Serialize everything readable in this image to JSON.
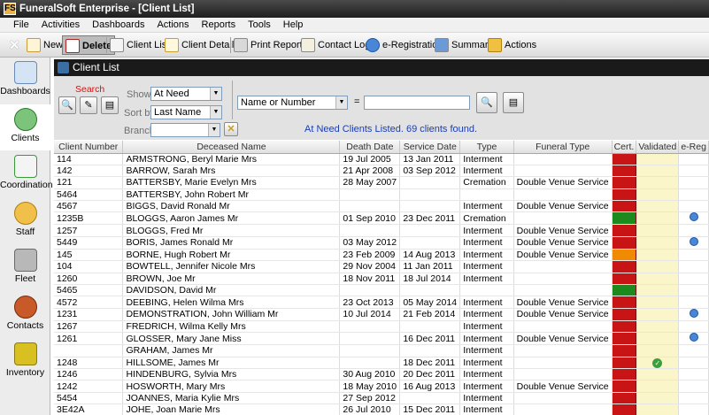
{
  "window": {
    "title": "FuneralSoft Enterprise - [Client List]",
    "logo_text": "FS"
  },
  "menu": [
    "File",
    "Activities",
    "Dashboards",
    "Actions",
    "Reports",
    "Tools",
    "Help"
  ],
  "toolbar": {
    "new": "New",
    "delete": "Delete",
    "client_list": "Client List",
    "client_details": "Client Details",
    "print_reports": "Print Reports",
    "contact_log": "Contact Log",
    "e_registration": "e-Registration",
    "summary": "Summary",
    "actions": "Actions"
  },
  "sidebar": {
    "items": [
      {
        "label": "Dashboards",
        "icon": "dashboard-icon"
      },
      {
        "label": "Clients",
        "icon": "clients-icon"
      },
      {
        "label": "Coordination",
        "icon": "calendar-icon"
      },
      {
        "label": "Staff",
        "icon": "staff-icon"
      },
      {
        "label": "Fleet",
        "icon": "key-icon"
      },
      {
        "label": "Contacts",
        "icon": "contacts-icon"
      },
      {
        "label": "Inventory",
        "icon": "truck-icon"
      }
    ]
  },
  "panel": {
    "title": "Client List"
  },
  "search": {
    "heading": "Search",
    "show_label": "Show:",
    "show_value": "At Need",
    "sort_label": "Sort by:",
    "sort_value": "Last Name",
    "branch_label": "Branch:",
    "branch_value": "",
    "field_value": "Name or Number",
    "equals": "=",
    "query_value": "",
    "clear_symbol": "✕",
    "info": "At Need Clients Listed. 69 clients found."
  },
  "table": {
    "columns": [
      "Client Number",
      "Deceased Name",
      "Death Date",
      "Service Date",
      "Type",
      "Funeral Type",
      "Cert.",
      "Validated",
      "e-Reg"
    ],
    "colors": {
      "red": "#c81414",
      "green": "#1c8a1c",
      "orange": "#f08a00"
    },
    "rows": [
      {
        "num": "114",
        "name": "ARMSTRONG, Beryl Marie Mrs",
        "death": "19 Jul 2005",
        "service": "13 Jan 2011",
        "type": "Interment",
        "funeral": "",
        "cert": "red",
        "valid": "",
        "ereg": ""
      },
      {
        "num": "142",
        "name": "BARROW, Sarah Mrs",
        "death": "21 Apr 2008",
        "service": "03 Sep 2012",
        "type": "Interment",
        "funeral": "",
        "cert": "red",
        "valid": "",
        "ereg": ""
      },
      {
        "num": "121",
        "name": "BATTERSBY, Marie Evelyn Mrs",
        "death": "28 May 2007",
        "service": "",
        "type": "Cremation",
        "funeral": "Double Venue Service",
        "cert": "red",
        "valid": "",
        "ereg": ""
      },
      {
        "num": "5464",
        "name": "BATTERSBY, John Robert Mr",
        "death": "",
        "service": "",
        "type": "",
        "funeral": "",
        "cert": "red",
        "valid": "",
        "ereg": ""
      },
      {
        "num": "4567",
        "name": "BIGGS, David Ronald Mr",
        "death": "",
        "service": "",
        "type": "Interment",
        "funeral": "Double Venue Service",
        "cert": "red",
        "valid": "",
        "ereg": ""
      },
      {
        "num": "1235B",
        "name": "BLOGGS, Aaron James Mr",
        "death": "01 Sep 2010",
        "service": "23 Dec 2011",
        "type": "Cremation",
        "funeral": "",
        "cert": "green",
        "valid": "",
        "ereg": "globe"
      },
      {
        "num": "1257",
        "name": "BLOGGS, Fred Mr",
        "death": "",
        "service": "",
        "type": "Interment",
        "funeral": "Double Venue Service",
        "cert": "red",
        "valid": "",
        "ereg": ""
      },
      {
        "num": "5449",
        "name": "BORIS, James Ronald Mr",
        "death": "03 May 2012",
        "service": "",
        "type": "Interment",
        "funeral": "Double Venue Service",
        "cert": "red",
        "valid": "",
        "ereg": "globe"
      },
      {
        "num": "145",
        "name": "BORNE, Hugh Robert Mr",
        "death": "23 Feb 2009",
        "service": "14 Aug 2013",
        "type": "Interment",
        "funeral": "Double Venue Service",
        "cert": "orange",
        "valid": "",
        "ereg": ""
      },
      {
        "num": "104",
        "name": "BOWTELL, Jennifer Nicole Mrs",
        "death": "29 Nov 2004",
        "service": "11 Jan 2011",
        "type": "Interment",
        "funeral": "",
        "cert": "red",
        "valid": "",
        "ereg": ""
      },
      {
        "num": "1260",
        "name": "BROWN, Joe Mr",
        "death": "18 Nov 2011",
        "service": "18 Jul 2014",
        "type": "Interment",
        "funeral": "",
        "cert": "red",
        "valid": "",
        "ereg": ""
      },
      {
        "num": "5465",
        "name": "DAVIDSON, David Mr",
        "death": "",
        "service": "",
        "type": "",
        "funeral": "",
        "cert": "green",
        "valid": "",
        "ereg": ""
      },
      {
        "num": "4572",
        "name": "DEEBING, Helen Wilma Mrs",
        "death": "23 Oct 2013",
        "service": "05 May 2014",
        "type": "Interment",
        "funeral": "Double Venue Service",
        "cert": "red",
        "valid": "",
        "ereg": ""
      },
      {
        "num": "1231",
        "name": "DEMONSTRATION, John William Mr",
        "death": "10 Jul 2014",
        "service": "21 Feb 2014",
        "type": "Interment",
        "funeral": "Double Venue Service",
        "cert": "red",
        "valid": "",
        "ereg": "globe"
      },
      {
        "num": "1267",
        "name": "FREDRICH, Wilma Kelly Mrs",
        "death": "",
        "service": "",
        "type": "Interment",
        "funeral": "",
        "cert": "red",
        "valid": "",
        "ereg": ""
      },
      {
        "num": "1261",
        "name": "GLOSSER, Mary Jane Miss",
        "death": "",
        "service": "16 Dec 2011",
        "type": "Interment",
        "funeral": "Double Venue Service",
        "cert": "red",
        "valid": "",
        "ereg": "globe"
      },
      {
        "num": "",
        "name": "GRAHAM, James Mr",
        "death": "",
        "service": "",
        "type": "Interment",
        "funeral": "",
        "cert": "red",
        "valid": "",
        "ereg": ""
      },
      {
        "num": "1248",
        "name": "HILLSOME, James Mr",
        "death": "",
        "service": "18 Dec 2011",
        "type": "Interment",
        "funeral": "",
        "cert": "red",
        "valid": "ok",
        "ereg": ""
      },
      {
        "num": "1246",
        "name": "HINDENBURG, Sylvia Mrs",
        "death": "30 Aug 2010",
        "service": "20 Dec 2011",
        "type": "Interment",
        "funeral": "",
        "cert": "red",
        "valid": "",
        "ereg": ""
      },
      {
        "num": "1242",
        "name": "HOSWORTH, Mary Mrs",
        "death": "18 May 2010",
        "service": "16 Aug 2013",
        "type": "Interment",
        "funeral": "Double Venue Service",
        "cert": "red",
        "valid": "",
        "ereg": ""
      },
      {
        "num": "5454",
        "name": "JOANNES, Maria Kylie Mrs",
        "death": "27 Sep 2012",
        "service": "",
        "type": "Interment",
        "funeral": "",
        "cert": "red",
        "valid": "",
        "ereg": ""
      },
      {
        "num": "3E42A",
        "name": "JOHE, Joan Marie Mrs",
        "death": "26 Jul 2010",
        "service": "15 Dec 2011",
        "type": "Interment",
        "funeral": "",
        "cert": "red",
        "valid": "",
        "ereg": ""
      }
    ]
  }
}
